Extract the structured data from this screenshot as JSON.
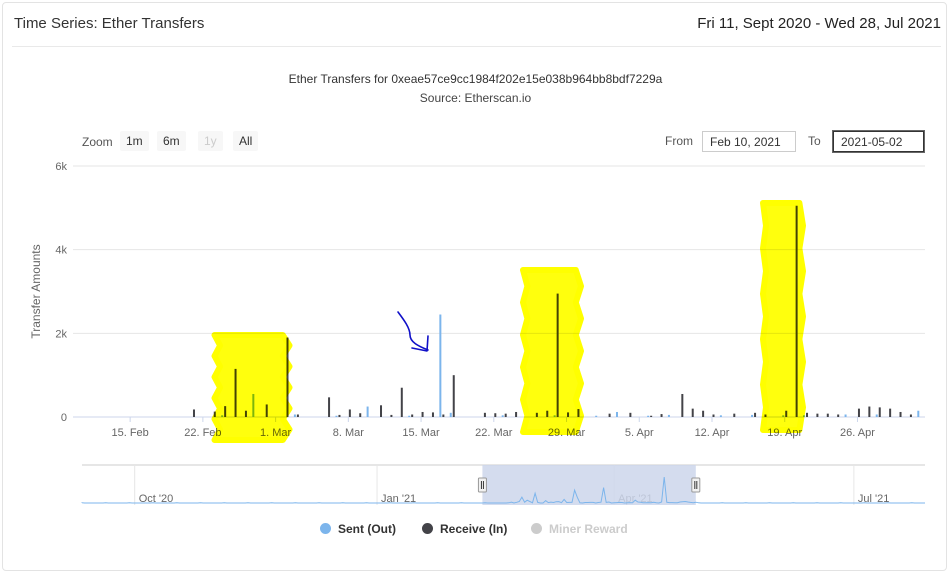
{
  "header": {
    "title": "Time Series: Ether Transfers",
    "range": "Fri 11, Sept 2020 - Wed 28, Jul 2021"
  },
  "toolbar": {
    "zoom_label": "Zoom",
    "zoom_buttons": [
      "1m",
      "6m",
      "1y",
      "All"
    ],
    "disabled_buttons": [
      "1y"
    ],
    "from_label": "From",
    "from_value": "Feb 10, 2021",
    "to_label": "To",
    "to_value": "2021-05-02"
  },
  "colors": {
    "sent": "#7cb5ec",
    "receive": "#434348",
    "miner": "#cccccc",
    "highlight": "#ffff00",
    "annotation_arrow": "#1010c8",
    "navigator_fill": "#ccd6eb"
  },
  "chart_data": {
    "type": "bar",
    "title": "Ether Transfers for 0xeae57ce9cc1984f202e15e038b964bb8bdf7229a",
    "subtitle": "Source: Etherscan.io",
    "ylabel": "Transfer Amounts",
    "ylim": [
      0,
      6000
    ],
    "y_ticks": [
      "0",
      "2k",
      "4k",
      "6k"
    ],
    "x_range": [
      "2021-02-10",
      "2021-05-02"
    ],
    "x_ticks": [
      {
        "date": "2021-02-15",
        "label": "15. Feb"
      },
      {
        "date": "2021-02-22",
        "label": "22. Feb"
      },
      {
        "date": "2021-03-01",
        "label": "1. Mar"
      },
      {
        "date": "2021-03-08",
        "label": "8. Mar"
      },
      {
        "date": "2021-03-15",
        "label": "15. Mar"
      },
      {
        "date": "2021-03-22",
        "label": "22. Mar"
      },
      {
        "date": "2021-03-29",
        "label": "29. Mar"
      },
      {
        "date": "2021-04-05",
        "label": "5. Apr"
      },
      {
        "date": "2021-04-12",
        "label": "12. Apr"
      },
      {
        "date": "2021-04-19",
        "label": "19. Apr"
      },
      {
        "date": "2021-04-26",
        "label": "26. Apr"
      }
    ],
    "series": [
      {
        "name": "Sent (Out)",
        "values": [
          [
            "2021-02-24",
            40
          ],
          [
            "2021-02-27",
            550
          ],
          [
            "2021-03-03",
            60
          ],
          [
            "2021-03-07",
            30
          ],
          [
            "2021-03-10",
            250
          ],
          [
            "2021-03-14",
            30
          ],
          [
            "2021-03-17",
            2450
          ],
          [
            "2021-03-18",
            100
          ],
          [
            "2021-03-23",
            40
          ],
          [
            "2021-03-28",
            40
          ],
          [
            "2021-04-01",
            30
          ],
          [
            "2021-04-03",
            120
          ],
          [
            "2021-04-06",
            30
          ],
          [
            "2021-04-08",
            50
          ],
          [
            "2021-04-13",
            40
          ],
          [
            "2021-04-16",
            50
          ],
          [
            "2021-04-19",
            40
          ],
          [
            "2021-04-21",
            40
          ],
          [
            "2021-04-25",
            60
          ],
          [
            "2021-04-28",
            60
          ],
          [
            "2021-05-02",
            150
          ]
        ]
      },
      {
        "name": "Receive (In)",
        "values": [
          [
            "2021-02-21",
            180
          ],
          [
            "2021-02-23",
            130
          ],
          [
            "2021-02-24",
            260
          ],
          [
            "2021-02-25",
            1150
          ],
          [
            "2021-02-26",
            150
          ],
          [
            "2021-02-28",
            300
          ],
          [
            "2021-03-02",
            1900
          ],
          [
            "2021-03-03",
            60
          ],
          [
            "2021-03-06",
            470
          ],
          [
            "2021-03-07",
            50
          ],
          [
            "2021-03-08",
            180
          ],
          [
            "2021-03-09",
            90
          ],
          [
            "2021-03-11",
            280
          ],
          [
            "2021-03-12",
            50
          ],
          [
            "2021-03-13",
            700
          ],
          [
            "2021-03-14",
            60
          ],
          [
            "2021-03-15",
            120
          ],
          [
            "2021-03-16",
            110
          ],
          [
            "2021-03-17",
            60
          ],
          [
            "2021-03-18",
            1000
          ],
          [
            "2021-03-21",
            100
          ],
          [
            "2021-03-22",
            90
          ],
          [
            "2021-03-23",
            80
          ],
          [
            "2021-03-24",
            120
          ],
          [
            "2021-03-26",
            100
          ],
          [
            "2021-03-27",
            150
          ],
          [
            "2021-03-28",
            2950
          ],
          [
            "2021-03-29",
            110
          ],
          [
            "2021-03-30",
            190
          ],
          [
            "2021-04-02",
            80
          ],
          [
            "2021-04-04",
            100
          ],
          [
            "2021-04-06",
            30
          ],
          [
            "2021-04-07",
            70
          ],
          [
            "2021-04-09",
            550
          ],
          [
            "2021-04-10",
            200
          ],
          [
            "2021-04-11",
            150
          ],
          [
            "2021-04-12",
            60
          ],
          [
            "2021-04-14",
            80
          ],
          [
            "2021-04-16",
            100
          ],
          [
            "2021-04-17",
            60
          ],
          [
            "2021-04-19",
            150
          ],
          [
            "2021-04-20",
            5050
          ],
          [
            "2021-04-21",
            100
          ],
          [
            "2021-04-22",
            80
          ],
          [
            "2021-04-23",
            80
          ],
          [
            "2021-04-24",
            60
          ],
          [
            "2021-04-26",
            200
          ],
          [
            "2021-04-27",
            250
          ],
          [
            "2021-04-28",
            230
          ],
          [
            "2021-04-29",
            200
          ],
          [
            "2021-04-30",
            120
          ],
          [
            "2021-05-01",
            60
          ]
        ]
      },
      {
        "name": "Miner Reward",
        "values": []
      }
    ],
    "navigator": {
      "range": [
        "2020-09-11",
        "2021-07-28"
      ],
      "labels": [
        {
          "date": "2020-10-01",
          "label": "Oct '20"
        },
        {
          "date": "2021-01-01",
          "label": "Jan '21"
        },
        {
          "date": "2021-04-01",
          "label": "Apr '21"
        },
        {
          "date": "2021-07-01",
          "label": "Jul '21"
        }
      ],
      "selected": [
        "2021-02-10",
        "2021-05-02"
      ]
    },
    "legend_position": "bottom",
    "grid": true
  }
}
